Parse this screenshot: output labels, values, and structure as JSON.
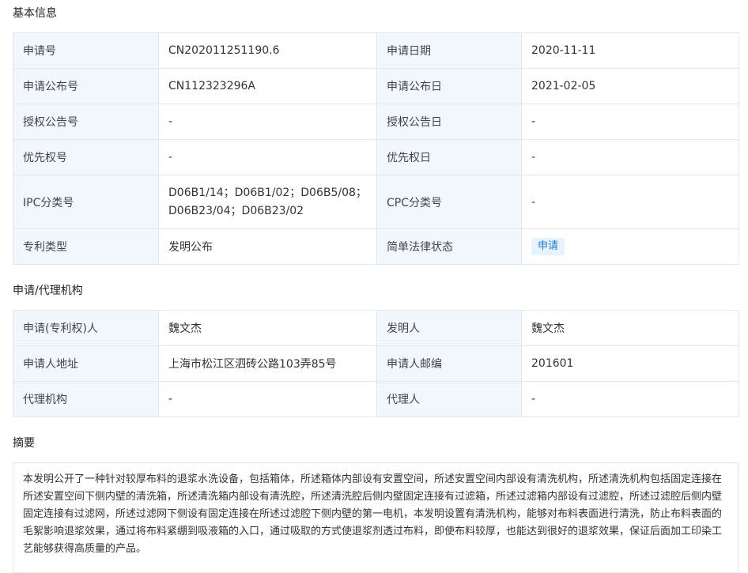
{
  "basic": {
    "title": "基本信息",
    "rows": [
      {
        "l1": "申请号",
        "v1": "CN202011251190.6",
        "l2": "申请日期",
        "v2": "2020-11-11"
      },
      {
        "l1": "申请公布号",
        "v1": "CN112323296A",
        "l2": "申请公布日",
        "v2": "2021-02-05"
      },
      {
        "l1": "授权公告号",
        "v1": "-",
        "l2": "授权公告日",
        "v2": "-"
      },
      {
        "l1": "优先权号",
        "v1": "-",
        "l2": "优先权日",
        "v2": "-"
      },
      {
        "l1": "IPC分类号",
        "v1a": "D06B1/14；D06B1/02；D06B5/08；",
        "v1b": "D06B23/04；D06B23/02",
        "l2": "CPC分类号",
        "v2": "-"
      },
      {
        "l1": "专利类型",
        "v1": "发明公布",
        "l2": "简单法律状态",
        "v2": "申请"
      }
    ]
  },
  "agency": {
    "title": "申请/代理机构",
    "rows": [
      {
        "l1": "申请(专利权)人",
        "v1": "魏文杰",
        "l2": "发明人",
        "v2": "魏文杰"
      },
      {
        "l1": "申请人地址",
        "v1": "上海市松江区泗砖公路103弄85号",
        "l2": "申请人邮编",
        "v2": "201601"
      },
      {
        "l1": "代理机构",
        "v1": "-",
        "l2": "代理人",
        "v2": "-"
      }
    ]
  },
  "abstract": {
    "title": "摘要",
    "text": "本发明公开了一种针对较厚布料的退浆水洗设备，包括箱体，所述箱体内部设有安置空间，所述安置空间内部设有清洗机构，所述清洗机构包括固定连接在所述安置空间下侧内壁的清洗箱，所述清洗箱内部设有清洗腔，所述清洗腔后侧内壁固定连接有过滤箱，所述过滤箱内部设有过滤腔，所述过滤腔后侧内壁固定连接有过滤网，所述过滤网下侧设有固定连接在所述过滤腔下侧内壁的第一电机，本发明设置有清洗机构，能够对布料表面进行清洗，防止布料表面的毛絮影响退浆效果，通过将布料紧绷到吸液箱的入口，通过吸取的方式使退浆剂透过布料，即使布料较厚，也能达到很好的退浆效果，保证后面加工印染工艺能够获得高质量的产品。"
  }
}
